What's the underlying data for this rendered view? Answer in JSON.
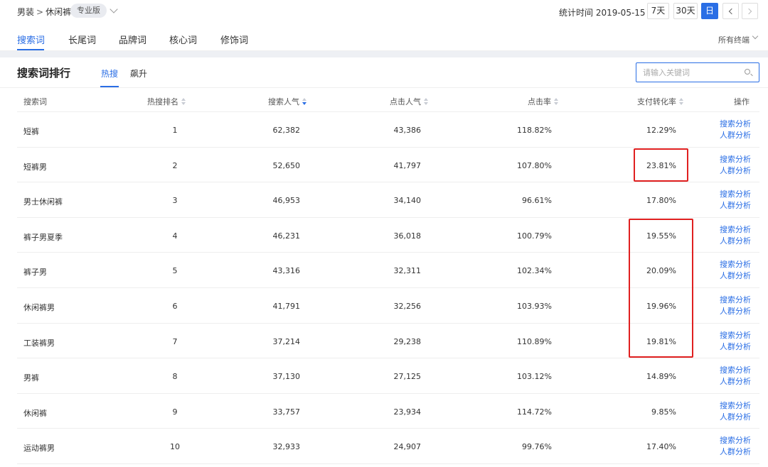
{
  "breadcrumb": {
    "root": "男装",
    "separator": ">",
    "current": "休闲裤"
  },
  "edition_badge": "专业版",
  "stat_time": "统计时间 2019-05-15",
  "period_buttons": [
    {
      "label": "7天",
      "active": false
    },
    {
      "label": "30天",
      "active": false
    },
    {
      "label": "日",
      "active": true
    }
  ],
  "tabs": [
    {
      "label": "搜索词",
      "active": true
    },
    {
      "label": "长尾词",
      "active": false
    },
    {
      "label": "品牌词",
      "active": false
    },
    {
      "label": "核心词",
      "active": false
    },
    {
      "label": "修饰词",
      "active": false
    }
  ],
  "terminal_filter": "所有终端",
  "section": {
    "title": "搜索词排行",
    "subtabs": [
      {
        "label": "热搜",
        "active": true
      },
      {
        "label": "飙升",
        "active": false
      }
    ],
    "search_placeholder": "请输入关键词"
  },
  "table": {
    "headers": {
      "term": "搜索词",
      "rank": "热搜排名",
      "popularity": "搜索人气",
      "clicks": "点击人气",
      "ctr": "点击率",
      "conversion": "支付转化率",
      "ops": "操作"
    },
    "sorted_column": "popularity",
    "sort_direction": "desc",
    "ops_links": [
      "搜索分析",
      "人群分析"
    ],
    "rows": [
      {
        "term": "短裤",
        "rank": "1",
        "popularity": "62,382",
        "clicks": "43,386",
        "ctr": "118.82%",
        "conversion": "12.29%"
      },
      {
        "term": "短裤男",
        "rank": "2",
        "popularity": "52,650",
        "clicks": "41,797",
        "ctr": "107.80%",
        "conversion": "23.81%"
      },
      {
        "term": "男士休闲裤",
        "rank": "3",
        "popularity": "46,953",
        "clicks": "34,140",
        "ctr": "96.61%",
        "conversion": "17.80%"
      },
      {
        "term": "裤子男夏季",
        "rank": "4",
        "popularity": "46,231",
        "clicks": "36,018",
        "ctr": "100.79%",
        "conversion": "19.55%"
      },
      {
        "term": "裤子男",
        "rank": "5",
        "popularity": "43,316",
        "clicks": "32,311",
        "ctr": "102.34%",
        "conversion": "20.09%"
      },
      {
        "term": "休闲裤男",
        "rank": "6",
        "popularity": "41,791",
        "clicks": "32,256",
        "ctr": "103.93%",
        "conversion": "19.96%"
      },
      {
        "term": "工装裤男",
        "rank": "7",
        "popularity": "37,214",
        "clicks": "29,238",
        "ctr": "110.89%",
        "conversion": "19.81%"
      },
      {
        "term": "男裤",
        "rank": "8",
        "popularity": "37,130",
        "clicks": "27,125",
        "ctr": "103.12%",
        "conversion": "14.89%"
      },
      {
        "term": "休闲裤",
        "rank": "9",
        "popularity": "33,757",
        "clicks": "23,934",
        "ctr": "114.72%",
        "conversion": "9.85%"
      },
      {
        "term": "运动裤男",
        "rank": "10",
        "popularity": "32,933",
        "clicks": "24,907",
        "ctr": "99.76%",
        "conversion": "17.40%"
      }
    ]
  },
  "annotations": {
    "color": "#e02020",
    "highlighted_conversion_rows": [
      [
        2
      ],
      [
        4,
        5,
        6,
        7
      ]
    ]
  },
  "colors": {
    "accent": "#2a6ee5",
    "divider": "#eeeeee",
    "strip": "#eef0f4"
  }
}
